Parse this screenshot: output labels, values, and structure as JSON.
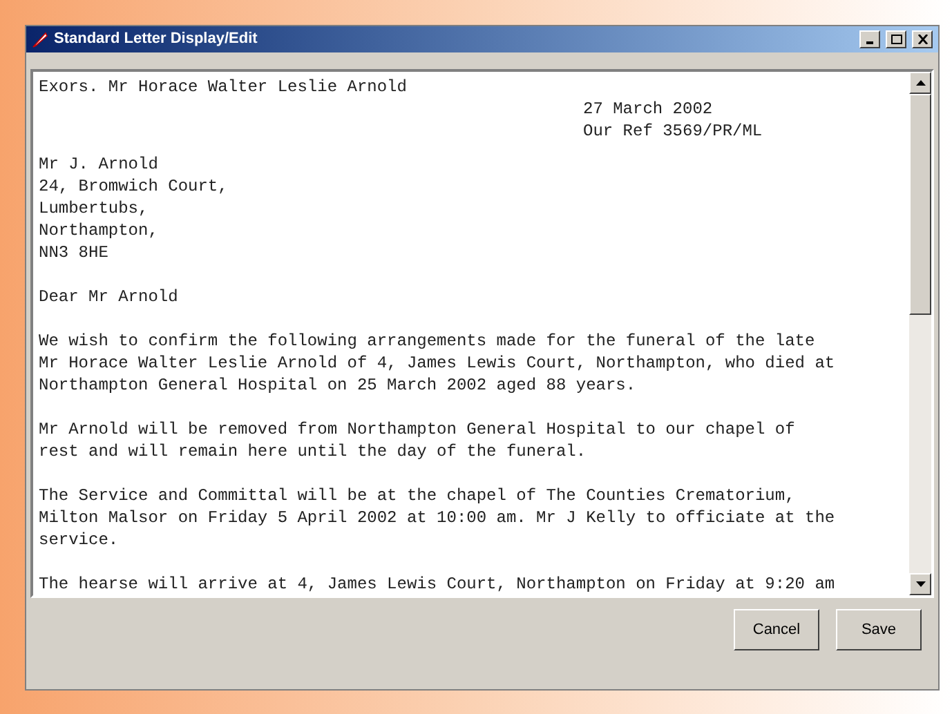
{
  "window": {
    "title": "Standard Letter Display/Edit"
  },
  "letter": {
    "heading": "Exors. Mr Horace Walter Leslie Arnold",
    "reference_lines": [
      "27 March 2002",
      "Our Ref 3569/PR/ML"
    ],
    "address_lines": [
      "Mr J. Arnold",
      "24, Bromwich Court,",
      "Lumbertubs,",
      "Northampton,",
      "NN3 8HE"
    ],
    "salutation": "Dear Mr Arnold",
    "paragraphs": [
      "We wish to confirm the following arrangements made for the funeral of the late\nMr Horace Walter Leslie Arnold of 4, James Lewis Court, Northampton, who died at\nNorthampton General Hospital on 25 March 2002 aged 88 years.",
      "Mr Arnold will be removed from Northampton General Hospital to our chapel of\nrest and will remain here until the day of the funeral.",
      "The Service and Committal will be at the chapel of The Counties Crematorium,\nMilton Malsor on Friday 5 April 2002 at 10:00 am. Mr J Kelly to officiate at the\nservice.",
      "The hearse will arrive at 4, James Lewis Court, Northampton on Friday at 9:20 am"
    ]
  },
  "buttons": [
    "Cancel",
    "Save"
  ]
}
